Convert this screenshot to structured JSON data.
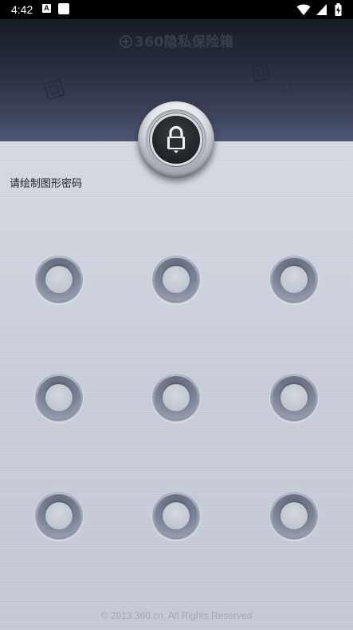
{
  "status_bar": {
    "time": "4:42",
    "notification_a": "A",
    "icons": [
      "notification-a-icon",
      "notification-square-icon",
      "wifi-icon",
      "cell-signal-icon",
      "battery-charging-icon"
    ]
  },
  "header": {
    "title": "360隐私保险箱"
  },
  "lock": {
    "icon": "lock-icon"
  },
  "pattern": {
    "hint": "请绘制图形密码",
    "dots": 9
  },
  "footer": {
    "copyright": "© 2013 360.cn, All Rights Reserved"
  },
  "colors": {
    "header_top": "#181d27",
    "header_bottom": "#4d5675",
    "panel": "#c8cdd8"
  }
}
